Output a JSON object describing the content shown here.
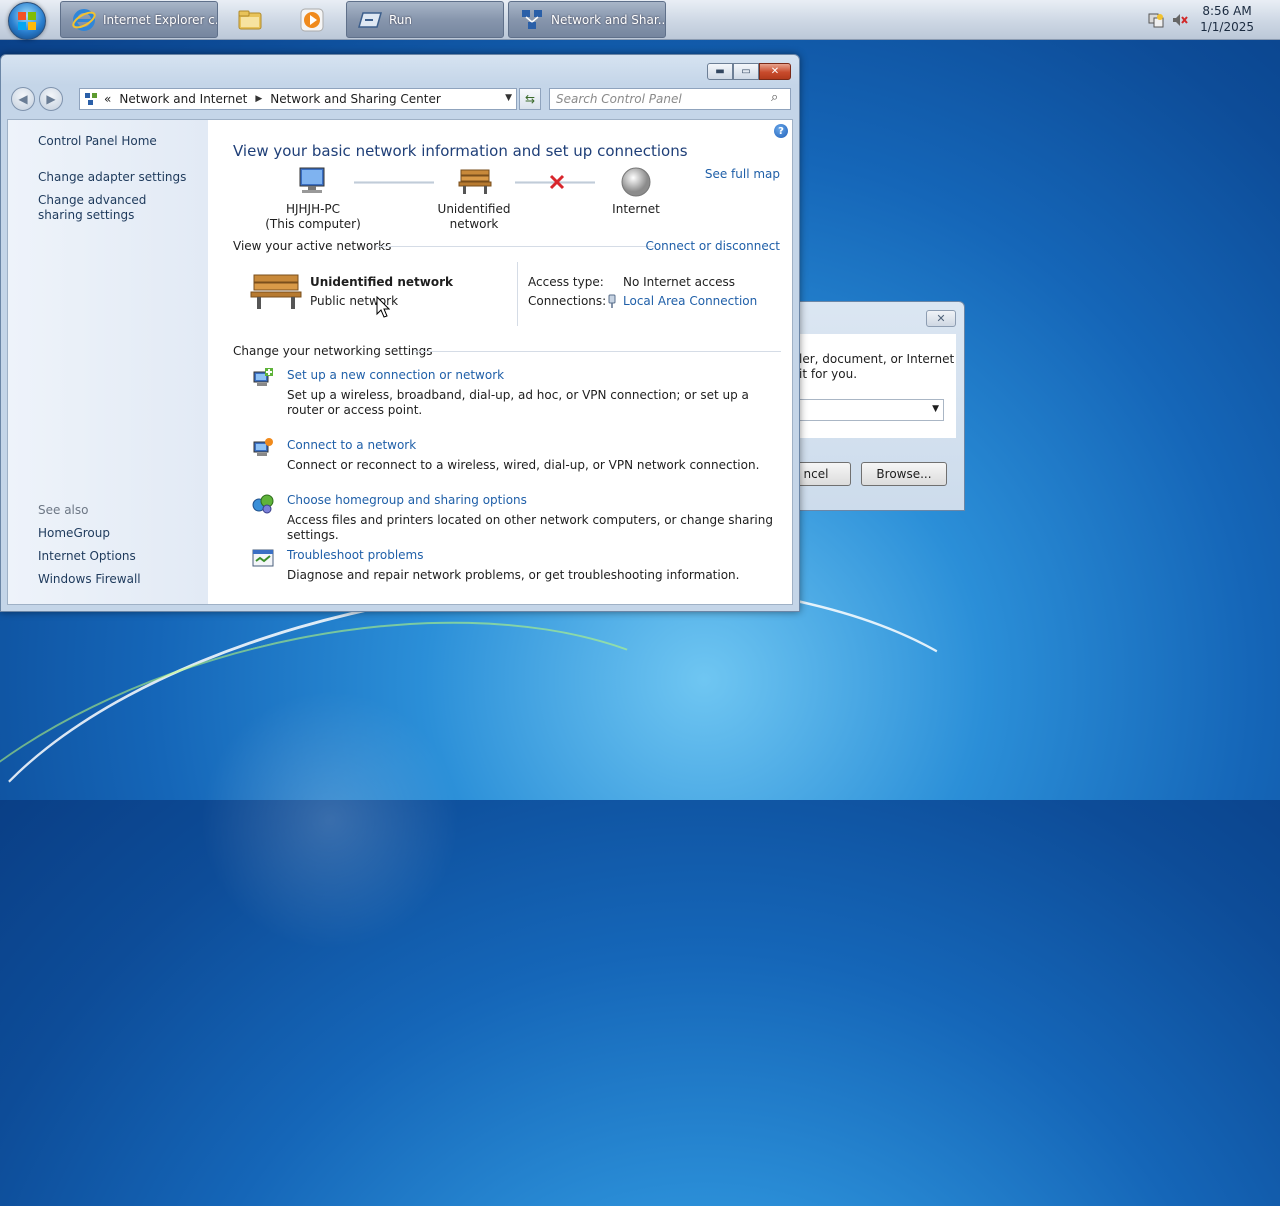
{
  "taskbar": {
    "items": [
      {
        "label": "Internet Explorer c...",
        "icon": "ie-icon"
      },
      {
        "label": "",
        "icon": "folder-icon"
      },
      {
        "label": "",
        "icon": "media-player-icon"
      },
      {
        "label": "Run",
        "icon": "run-icon"
      },
      {
        "label": "Network and Shar...",
        "icon": "network-icon"
      }
    ],
    "clock_time": "8:56 AM",
    "clock_date": "1/1/2025"
  },
  "window": {
    "breadcrumb": [
      "«",
      "Network and Internet",
      "Network and Sharing Center"
    ],
    "search_placeholder": "Search Control Panel",
    "left_pane": {
      "home": "Control Panel Home",
      "links": [
        "Change adapter settings",
        "Change advanced sharing settings"
      ],
      "see_also_label": "See also",
      "see_also": [
        "HomeGroup",
        "Internet Options",
        "Windows Firewall"
      ]
    },
    "title": "View your basic network information and set up connections",
    "see_full_map": "See full map",
    "map": {
      "computer_name": "HJHJH-PC",
      "computer_sub": "(This computer)",
      "network": "Unidentified network",
      "internet": "Internet"
    },
    "active_networks": {
      "header": "View your active networks",
      "connect_link": "Connect or disconnect",
      "network_name": "Unidentified network",
      "network_type": "Public network",
      "access_type_label": "Access type:",
      "access_type_value": "No Internet access",
      "connections_label": "Connections:",
      "connections_value": "Local Area Connection"
    },
    "settings": {
      "header": "Change your networking settings",
      "tasks": [
        {
          "title": "Set up a new connection or network",
          "desc": "Set up a wireless, broadband, dial-up, ad hoc, or VPN connection; or set up a router or access point."
        },
        {
          "title": "Connect to a network",
          "desc": "Connect or reconnect to a wireless, wired, dial-up, or VPN network connection."
        },
        {
          "title": "Choose homegroup and sharing options",
          "desc": "Access files and printers located on other network computers, or change sharing settings."
        },
        {
          "title": "Troubleshoot problems",
          "desc": "Diagnose and repair network problems, or get troubleshooting information."
        }
      ]
    }
  },
  "run_dialog": {
    "text_line1": "ler, document, or Internet",
    "text_line2": "it for you.",
    "cancel": "ncel",
    "browse": "Browse..."
  },
  "colors": {
    "link": "#1f5fa8",
    "title": "#1f3f78",
    "close": "#c84b2c"
  }
}
